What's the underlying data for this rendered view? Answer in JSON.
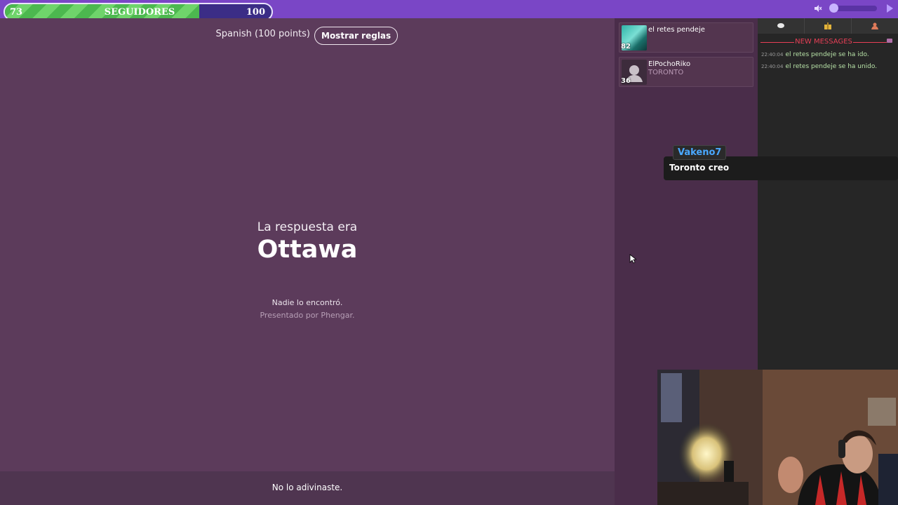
{
  "goal": {
    "current": "73",
    "label": "SEGUIDORES",
    "target": "100",
    "progress": 0.73
  },
  "game": {
    "language_label": "Spanish (100 points)",
    "rules_button": "Mostrar reglas",
    "answer_caption": "La respuesta era",
    "answer": "Ottawa",
    "nobody_found": "Nadie lo encontró.",
    "presented_by": "Presentado por Phengar.",
    "footer": "No lo adivinaste."
  },
  "players": [
    {
      "name": "el retes pendeje",
      "score": "82",
      "guess": ""
    },
    {
      "name": "ElPochoRiko",
      "score": "36",
      "guess": "TORONTO"
    }
  ],
  "chat": {
    "new_messages": "NEW MESSAGES",
    "lines": [
      {
        "time": "22:40:04",
        "text": "el retes pendeje se ha ido."
      },
      {
        "time": "22:40:04",
        "text": "el retes pendeje se ha unido."
      }
    ]
  },
  "overlay": {
    "username": "Vakeno7",
    "message": "Toronto creo"
  },
  "colors": {
    "topbar": "#7a46c6",
    "game_bg": "#5c3b5b",
    "goal_fill": "#4cb84f",
    "popup_name": "#4aa8ff",
    "new_messages": "#e83f56"
  },
  "icons": [
    "mute-icon",
    "play-icon",
    "chat-bubble-icon",
    "gift-icon",
    "user-icon",
    "default-avatar-icon",
    "cursor-arrow-icon"
  ]
}
